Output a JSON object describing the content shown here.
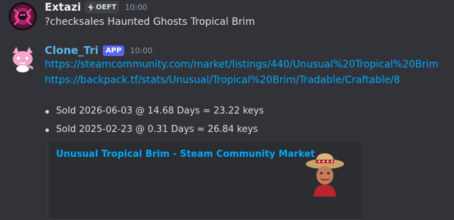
{
  "messages": [
    {
      "username": "Extazi",
      "username_color": "#f2f3f5",
      "tag": {
        "icon": "lightning-icon",
        "label": "OEFT"
      },
      "time": "10:00",
      "text": "?checksales Haunted Ghosts Tropical Brim"
    },
    {
      "username": "Clone_Tri",
      "username_color": "#59b5e9",
      "badge": "APP",
      "time": "10:00",
      "links": [
        "https://steamcommunity.com/market/listings/440/Unusual%20Tropical%20Brim",
        "https://backpack.tf/stats/Unusual/Tropical%20Brim/Tradable/Craftable/8"
      ],
      "sales": [
        "Sold 2026-06-03 @ 14.68 Days ≈ 23.22 keys",
        "Sold 2025-02-23 @ 0.31 Days ≈ 26.84 keys"
      ],
      "embed": {
        "title": "Unusual Tropical Brim - Steam Community Market",
        "thumbnail_icon": "tropical-brim-hat-icon"
      }
    }
  ],
  "colors": {
    "background": "#323339",
    "link": "#00a8fc",
    "app_badge": "#5865f2",
    "embed_bg": "#2b2d31"
  }
}
